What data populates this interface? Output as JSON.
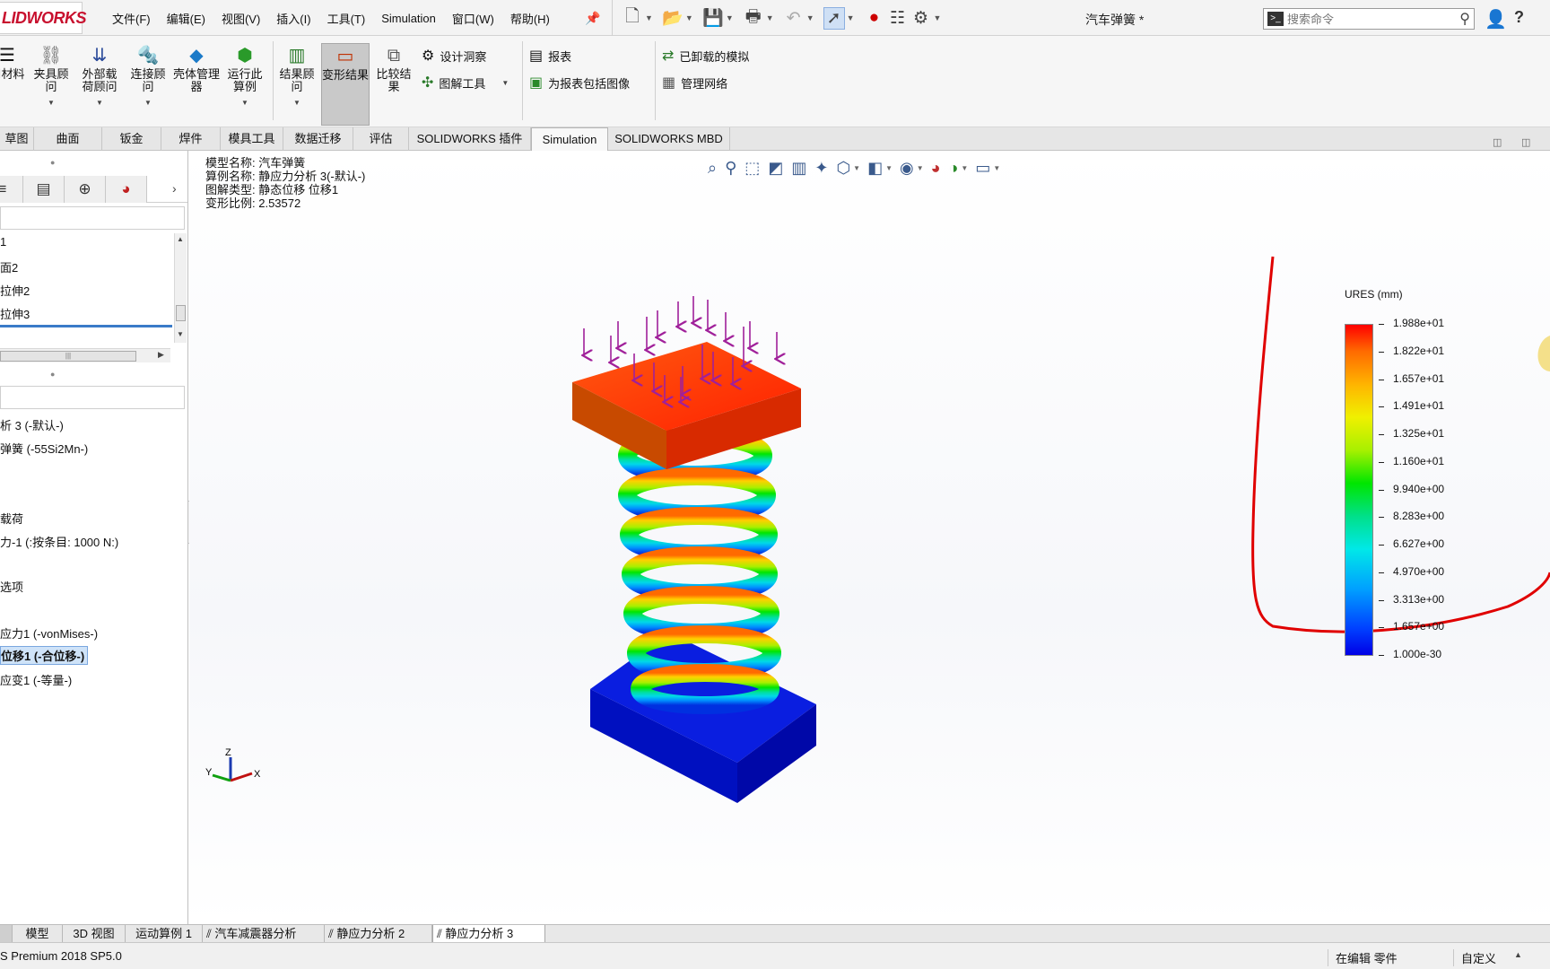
{
  "app": {
    "logo": "LIDWORKS",
    "document_title": "汽车弹簧 *",
    "menus": [
      "文件(F)",
      "编辑(E)",
      "视图(V)",
      "插入(I)",
      "工具(T)",
      "Simulation",
      "窗口(W)",
      "帮助(H)"
    ],
    "search_placeholder": "搜索命令"
  },
  "ribbon": {
    "buttons": [
      {
        "id": "apply-material",
        "label": "用材料",
        "icon": "material-icon"
      },
      {
        "id": "fixtures-advisor",
        "label": "夹具顾问",
        "icon": "fixture-icon"
      },
      {
        "id": "external-loads-advisor",
        "label": "外部载荷顾问",
        "icon": "load-icon"
      },
      {
        "id": "connections-advisor",
        "label": "连接顾问",
        "icon": "bolt-icon"
      },
      {
        "id": "shell-manager",
        "label": "壳体管理器",
        "icon": "shell-icon"
      },
      {
        "id": "run-study",
        "label": "运行此算例",
        "icon": "run-icon"
      },
      {
        "id": "results-advisor",
        "label": "结果顾问",
        "icon": "results-icon"
      },
      {
        "id": "deformed-result",
        "label": "变形结果",
        "icon": "deform-icon"
      },
      {
        "id": "compare-results",
        "label": "比较结果",
        "icon": "compare-icon"
      }
    ],
    "small": {
      "design_insight": "设计洞察",
      "plot_tools": "图解工具",
      "report": "报表",
      "include_image": "为报表包括图像",
      "unloaded_sims": "已卸载的模拟",
      "manage_network": "管理网络"
    }
  },
  "command_tabs": [
    "草图",
    "曲面",
    "钣金",
    "焊件",
    "模具工具",
    "数据迁移",
    "评估",
    "SOLIDWORKS 插件",
    "Simulation",
    "SOLIDWORKS MBD"
  ],
  "feature_tree": {
    "items": [
      "1",
      "面2",
      "拉伸2",
      "拉伸3"
    ]
  },
  "study_tree": {
    "items": [
      {
        "label": "析 3 (-默认-)"
      },
      {
        "label": "弹簧 (-55Si2Mn-)"
      },
      {
        "label": "载荷"
      },
      {
        "label": "力-1 (:按条目: 1000 N:)"
      },
      {
        "label": "选项"
      },
      {
        "label": "应力1 (-vonMises-)"
      },
      {
        "label": "位移1 (-合位移-)",
        "selected": true
      },
      {
        "label": "应变1 (-等量-)"
      }
    ]
  },
  "plot_info": {
    "model_name": "模型名称: 汽车弹簧",
    "study_name": "算例名称: 静应力分析 3(-默认-)",
    "plot_type": "图解类型: 静态位移 位移1",
    "deform_scale": "变形比例: 2.53572"
  },
  "legend": {
    "title": "URES (mm)",
    "values": [
      "1.988e+01",
      "1.822e+01",
      "1.657e+01",
      "1.491e+01",
      "1.325e+01",
      "1.160e+01",
      "9.940e+00",
      "8.283e+00",
      "6.627e+00",
      "4.970e+00",
      "3.313e+00",
      "1.657e+00",
      "1.000e-30"
    ],
    "colors_top_to_bottom": [
      "#ff0000",
      "#ff6a00",
      "#ffb400",
      "#f0f000",
      "#a8f000",
      "#00e600",
      "#00e08a",
      "#00e8e8",
      "#00a0ff",
      "#0040ff",
      "#0000e6"
    ],
    "annotation_color": "#e00000"
  },
  "triad": {
    "z": "Z",
    "y": "Y",
    "x": "X"
  },
  "bottom_tabs": [
    "模型",
    "3D 视图",
    "运动算例 1",
    "汽车减震器分析",
    "静应力分析 2",
    "静应力分析 3"
  ],
  "status": {
    "version": "S Premium 2018 SP5.0",
    "editing": "在编辑 零件",
    "custom": "自定义"
  }
}
